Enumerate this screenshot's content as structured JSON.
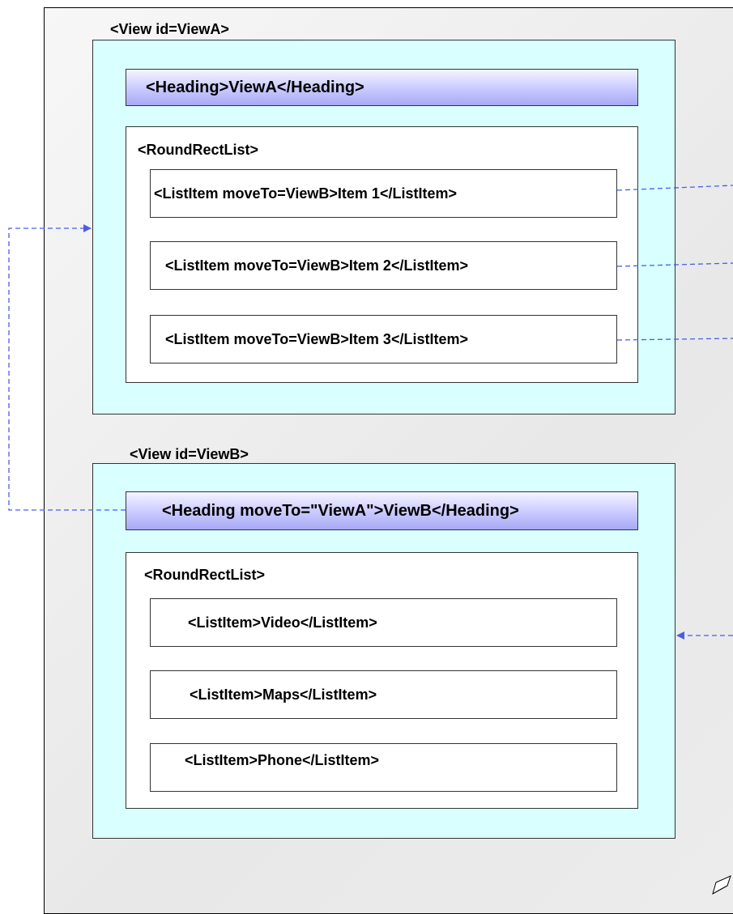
{
  "view_a": {
    "label": "<View id=ViewA>",
    "heading": "<Heading>ViewA</Heading>",
    "list_label": "<RoundRectList>",
    "items": [
      "<ListItem moveTo=ViewB>Item 1</ListItem>",
      "<ListItem moveTo=ViewB>Item 2</ListItem>",
      "<ListItem moveTo=ViewB>Item 3</ListItem>"
    ]
  },
  "view_b": {
    "label": "<View id=ViewB>",
    "heading": "<Heading moveTo=\"ViewA\">ViewB</Heading>",
    "list_label": "<RoundRectList>",
    "items": [
      "<ListItem>Video</ListItem>",
      "<ListItem>Maps</ListItem>",
      "<ListItem>Phone</ListItem>"
    ]
  },
  "colors": {
    "view_fill": "#d9ffff",
    "heading_gradient_dark": "#a7a8f5",
    "connector": "#4a5de8"
  }
}
